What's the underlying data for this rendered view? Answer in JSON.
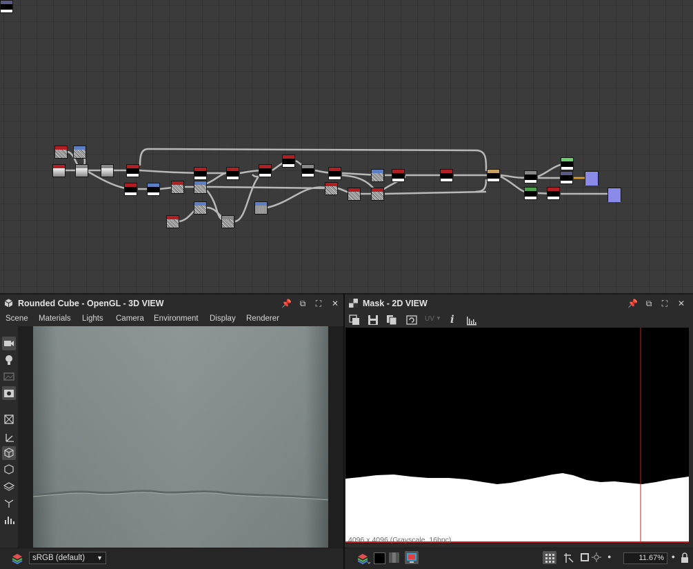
{
  "graph": {
    "nodes": [
      {
        "hd": "#b11e24",
        "bd": "noise"
      },
      {
        "hd": "#5b7fc2",
        "bd": "noise"
      },
      {
        "hd": "#b11e24",
        "bd": "grad"
      },
      {
        "hd": "#888",
        "bd": "grad"
      },
      {
        "hd": "#888",
        "bd": "grad"
      },
      {
        "hd": "#b11e24",
        "bd": "black"
      },
      {
        "hd": "#b11e24",
        "bd": "black"
      },
      {
        "hd": "#5b7fc2",
        "bd": "black"
      },
      {
        "hd": "#b11e24",
        "bd": "noise"
      },
      {
        "hd": "#5b7fc2",
        "bd": "noise"
      },
      {
        "hd": "#b11e24",
        "bd": "black"
      },
      {
        "hd": "#b11e24",
        "bd": "black"
      },
      {
        "hd": "#b11e24",
        "bd": "black"
      },
      {
        "hd": "#b11e24",
        "bd": "black"
      },
      {
        "hd": "#888",
        "bd": "black"
      },
      {
        "hd": "#b11e24",
        "bd": "black"
      },
      {
        "hd": "#5b7fc2",
        "bd": "noise"
      },
      {
        "hd": "#b11e24",
        "bd": "noise"
      },
      {
        "hd": "#888",
        "bd": "noise"
      },
      {
        "hd": "#5b7fc2",
        "bd": "grey"
      },
      {
        "hd": "#b11e24",
        "bd": "noise"
      },
      {
        "hd": "#b11e24",
        "bd": "noise"
      },
      {
        "hd": "#b11e24",
        "bd": "noise"
      },
      {
        "hd": "#5b7fc2",
        "bd": "noise"
      },
      {
        "hd": "#b11e24",
        "bd": "black"
      },
      {
        "hd": "#b11e24",
        "bd": "black"
      },
      {
        "hd": "#c8a060",
        "bd": "black"
      },
      {
        "hd": "#888",
        "bd": "black"
      },
      {
        "hd": "#4ca34c",
        "bd": "black"
      },
      {
        "hd": "#b11e24",
        "bd": "black"
      },
      {
        "hd": "#6ad06a",
        "bd": "black"
      },
      {
        "hd": "#5a5a8a",
        "bd": "black"
      },
      {
        "hd": "#8a8ae8",
        "bd": "violet"
      },
      {
        "hd": "#8a8ae8",
        "bd": "violet"
      },
      {
        "hd": "#5a5a8a",
        "bd": "black"
      }
    ]
  },
  "panel3d": {
    "title": "Rounded Cube - OpenGL - 3D VIEW",
    "menu": [
      "Scene",
      "Materials",
      "Lights",
      "Camera",
      "Environment",
      "Display",
      "Renderer"
    ],
    "colorspace": "sRGB (default)"
  },
  "panel2d": {
    "title": "Mask - 2D VIEW",
    "uv_label": "UV",
    "image_info": "4096 x 4096 (Grayscale, 16bpc)",
    "zoom": "11.67%",
    "cursor_fraction_x": 0.86,
    "colors": {
      "mask": "#ffffff",
      "background": "#000000",
      "cursor": "#c8201c"
    }
  }
}
